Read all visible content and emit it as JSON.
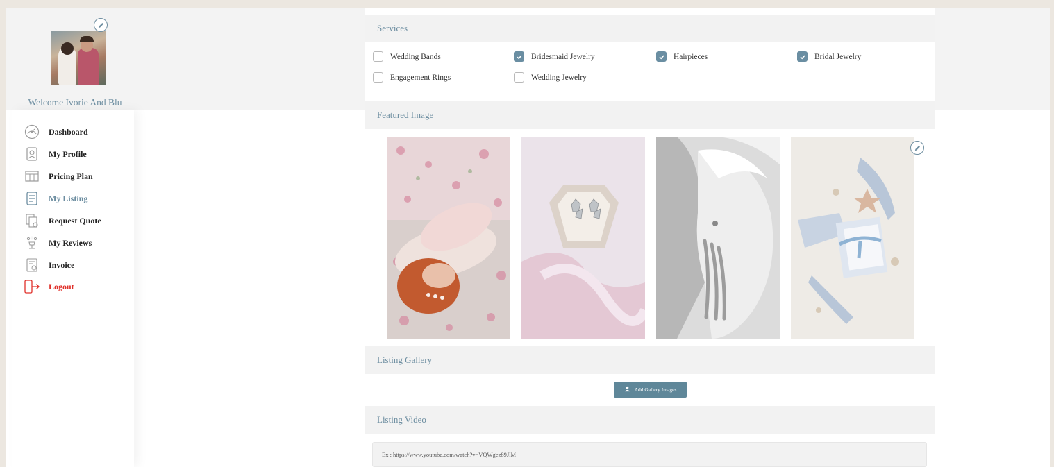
{
  "profile": {
    "welcome": "Welcome Ivorie And Blu"
  },
  "sidebar": {
    "items": [
      {
        "label": "Dashboard",
        "icon": "dashboard-gauge-icon"
      },
      {
        "label": "My Profile",
        "icon": "profile-card-icon"
      },
      {
        "label": "Pricing Plan",
        "icon": "pricing-table-icon"
      },
      {
        "label": "My Listing",
        "icon": "listing-document-icon",
        "active": true
      },
      {
        "label": "Request Quote",
        "icon": "quote-documents-icon"
      },
      {
        "label": "My Reviews",
        "icon": "reviews-trophy-icon"
      },
      {
        "label": "Invoice",
        "icon": "invoice-icon"
      },
      {
        "label": "Logout",
        "icon": "logout-door-icon"
      }
    ],
    "active_color": "#6c8da0",
    "logout_color": "#e0302a"
  },
  "services": {
    "title": "Services",
    "options": [
      {
        "label": "Wedding Bands",
        "checked": false
      },
      {
        "label": "Bridesmaid Jewelry",
        "checked": true
      },
      {
        "label": "Hairpieces",
        "checked": true
      },
      {
        "label": "Bridal Jewelry",
        "checked": true
      },
      {
        "label": "Engagement Rings",
        "checked": false
      },
      {
        "label": "Wedding Jewelry",
        "checked": false
      }
    ]
  },
  "featured": {
    "title": "Featured Image",
    "images": [
      "bride-lying-in-flowers-photo",
      "earrings-in-ring-box-photo",
      "bride-earring-bw-photo",
      "bridal-shoes-flatlay-photo"
    ]
  },
  "gallery": {
    "title": "Listing Gallery",
    "button_label": "Add Gallery Images",
    "button_icon": "upload-user-icon"
  },
  "video": {
    "title": "Listing Video",
    "placeholder": "Ex : https://www.youtube.com/watch?v=VQWgez89JlM"
  },
  "colors": {
    "accent": "#6a8ea2",
    "button": "#5f8799",
    "page_bg": "#ece7e0"
  }
}
